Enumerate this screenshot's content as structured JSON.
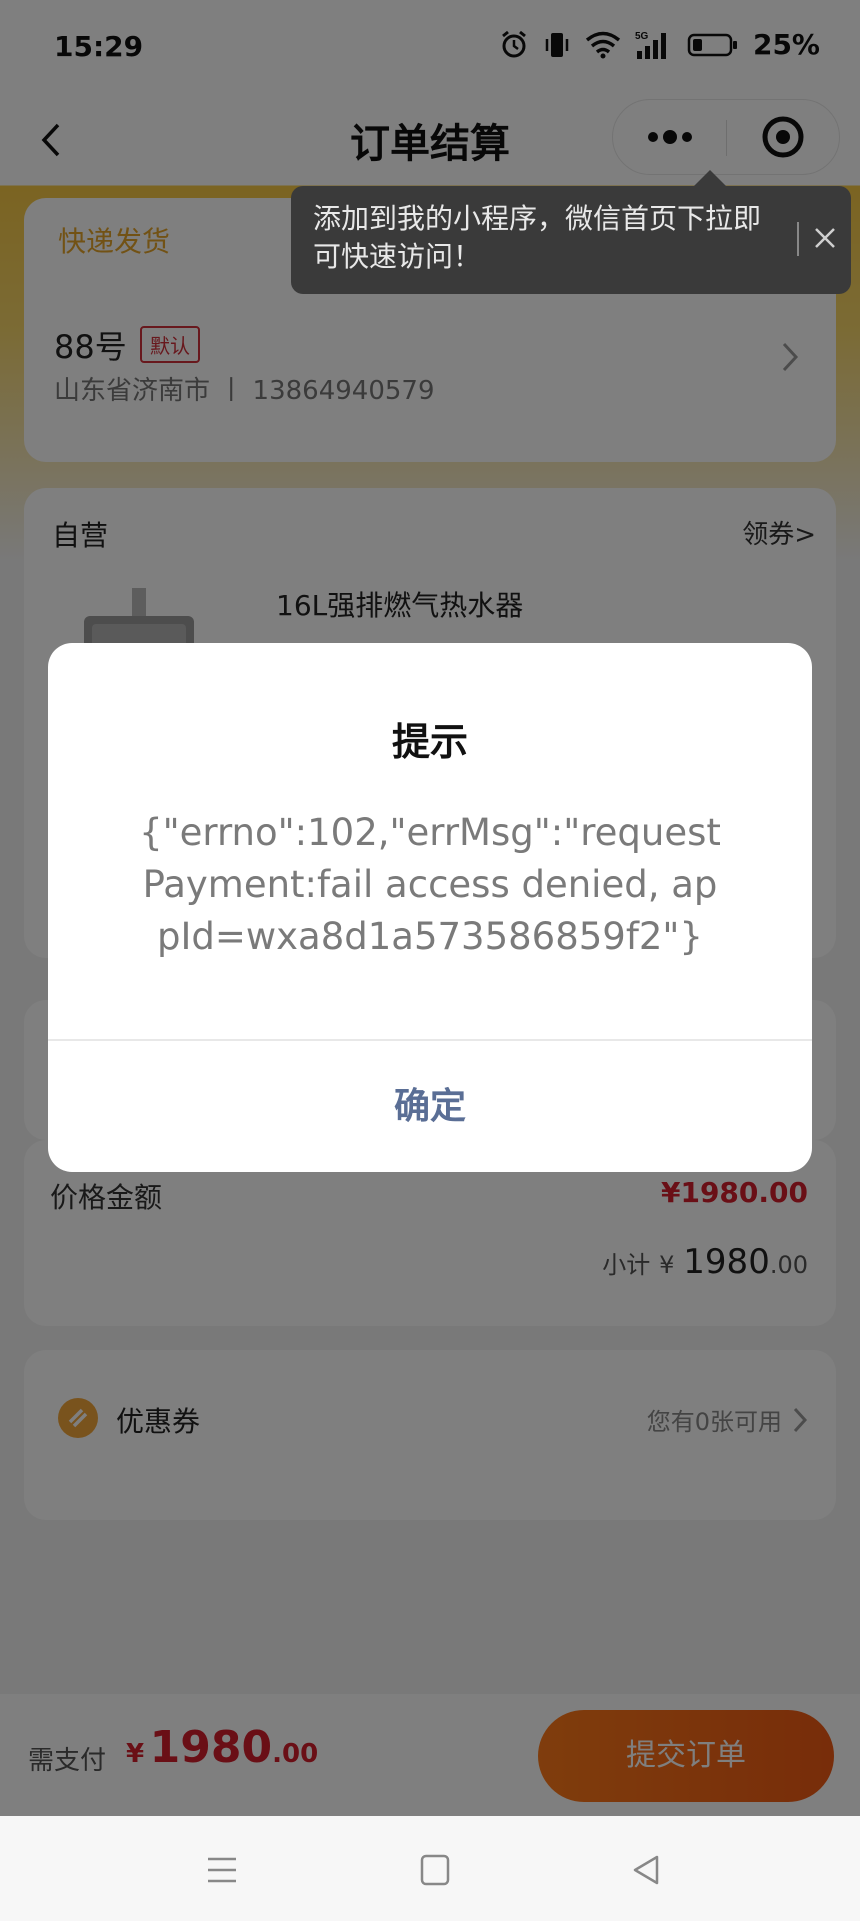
{
  "status_bar": {
    "time": "15:29",
    "battery": "25%"
  },
  "nav": {
    "title": "订单结算"
  },
  "tooltip": {
    "text": "添加到我的小程序，微信首页下拉即可快速访问！"
  },
  "address": {
    "ship_label": "快递发货",
    "name": "88号",
    "default_badge": "默认",
    "detail": "山东省济南市 丨 13864940579"
  },
  "product_section": {
    "store": "自营",
    "coupon_link": "领券>",
    "product_name": "16L强排燃气热水器"
  },
  "price_section": {
    "label": "价格金额",
    "value": "¥1980.00",
    "subtotal_label": "小计",
    "subtotal_currency": "¥",
    "subtotal_int": "1980",
    "subtotal_dec": ".00"
  },
  "coupon_section": {
    "label": "优惠券",
    "available": "您有0张可用"
  },
  "bottom": {
    "pay_label": "需支付",
    "pay_currency": "¥",
    "pay_int": "1980",
    "pay_dec": ".00",
    "submit": "提交订单"
  },
  "modal": {
    "title": "提示",
    "message": "{\"errno\":102,\"errMsg\":\"requestPayment:fail access denied, appId=wxa8d1a573586859f2\"}",
    "ok": "确定"
  },
  "colors": {
    "price_red": "#d41f2c",
    "submit_orange": "#f05a14",
    "ship_label_orange": "#e5a52a",
    "modal_button_blue": "#5a6e95"
  }
}
